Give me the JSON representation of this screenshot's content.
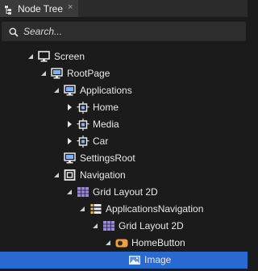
{
  "tab": {
    "title": "Node Tree",
    "close": "×"
  },
  "search": {
    "placeholder": "Search..."
  },
  "tree": [
    {
      "label": "Screen",
      "icon": "screen-icon",
      "toggle": "expanded"
    },
    {
      "label": "RootPage",
      "icon": "page-icon",
      "toggle": "expanded"
    },
    {
      "label": "Applications",
      "icon": "page-icon",
      "toggle": "expanded"
    },
    {
      "label": "Home",
      "icon": "component-icon",
      "toggle": "collapsed"
    },
    {
      "label": "Media",
      "icon": "component-icon",
      "toggle": "collapsed"
    },
    {
      "label": "Car",
      "icon": "component-icon",
      "toggle": "collapsed"
    },
    {
      "label": "SettingsRoot",
      "icon": "page-icon",
      "toggle": "none"
    },
    {
      "label": "Navigation",
      "icon": "node-icon",
      "toggle": "expanded"
    },
    {
      "label": "Grid Layout 2D",
      "icon": "grid-layout-icon",
      "toggle": "expanded"
    },
    {
      "label": "ApplicationsNavigation",
      "icon": "list-icon",
      "toggle": "expanded"
    },
    {
      "label": "Grid Layout 2D",
      "icon": "grid-layout-icon",
      "toggle": "expanded"
    },
    {
      "label": "HomeButton",
      "icon": "button-icon",
      "toggle": "expanded"
    },
    {
      "label": "Image",
      "icon": "image-icon",
      "toggle": "none",
      "selected": true
    }
  ],
  "colors": {
    "selection": "#2a6ad0",
    "icon_blue": "#7fb0ff",
    "icon_orange": "#f0a040"
  }
}
